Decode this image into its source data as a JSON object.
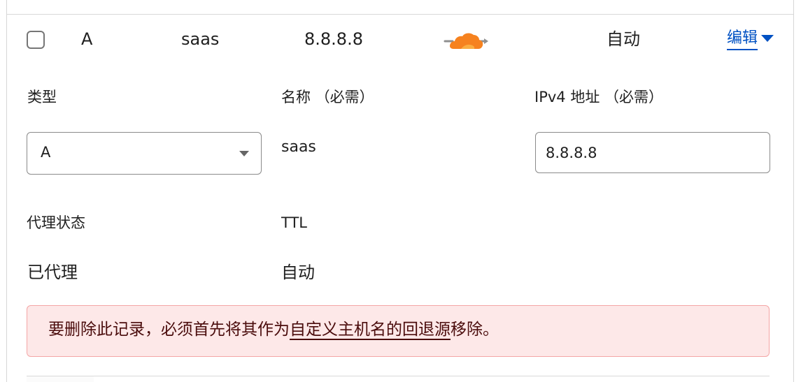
{
  "record": {
    "type": "A",
    "name": "saas",
    "content": "8.8.8.8",
    "ttl": "自动",
    "edit_label": "编辑"
  },
  "form": {
    "type_label": "类型",
    "name_label": "名称 （必需）",
    "ipv4_label": "IPv4 地址 （必需）",
    "type_value": "A",
    "name_value": "saas",
    "ipv4_value": "8.8.8.8",
    "proxy_label": "代理状态",
    "ttl_label": "TTL",
    "proxy_value": "已代理",
    "ttl_value": "自动"
  },
  "alert": {
    "prefix": "要删除此记录，必须首先将其作为",
    "link_text": "自定义主机名的回退源",
    "suffix": "移除。"
  },
  "colors": {
    "link": "#0051c3",
    "alert_bg": "#fde8e8",
    "alert_border": "#f4a5a5",
    "alert_text": "#4a0c0c",
    "proxy_cloud": "#f6821f",
    "proxy_arrow": "#8f8f8f"
  },
  "icons": {
    "proxy": "proxied-cloud-icon",
    "edit_caret": "caret-down-icon",
    "select_caret": "chevron-down-icon",
    "checkbox": "checkbox-icon"
  }
}
